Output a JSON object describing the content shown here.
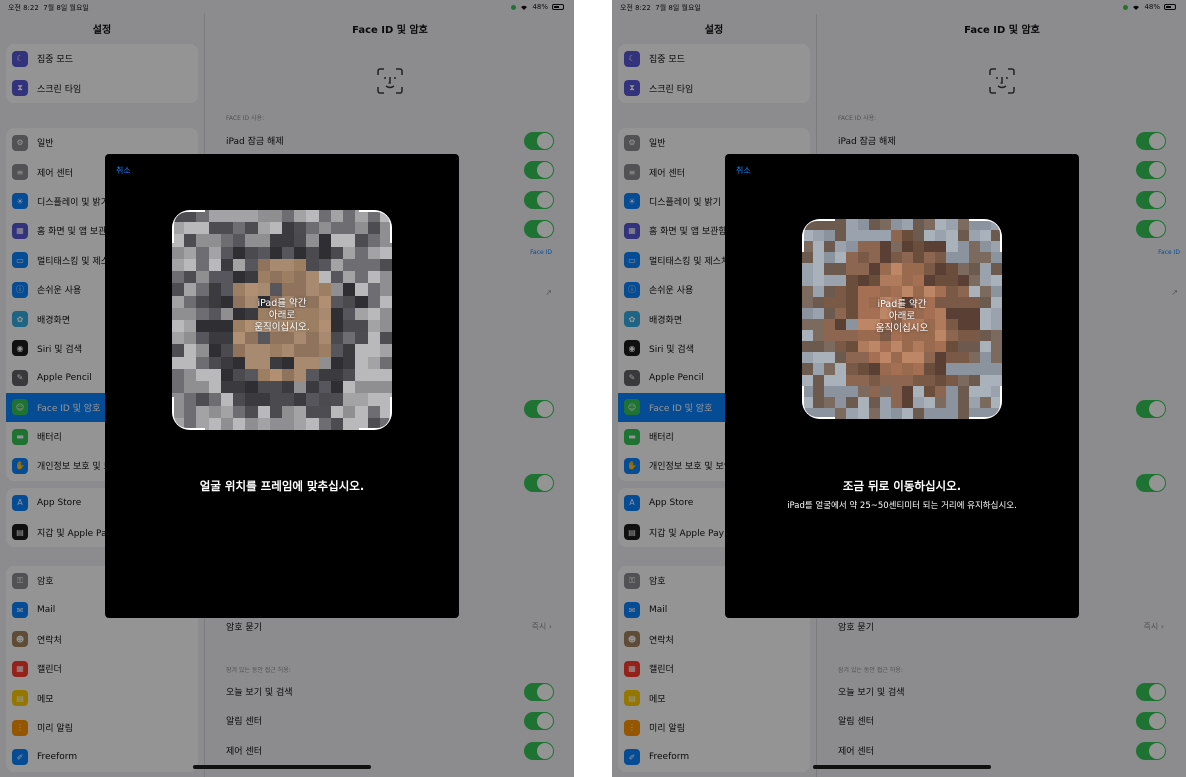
{
  "status": {
    "time": "오전 8:22",
    "date": "7월 8일 월요일",
    "battery": "48%"
  },
  "sidebar": {
    "title": "설정",
    "groups": [
      [
        {
          "label": "집중 모드",
          "icon": "moon-icon",
          "color": "#5856d6"
        },
        {
          "label": "스크린 타임",
          "icon": "hourglass-icon",
          "color": "#5856d6"
        }
      ],
      [
        {
          "label": "일반",
          "icon": "gear-icon",
          "color": "#8e8e93"
        },
        {
          "label": "제어 센터",
          "icon": "switches-icon",
          "color": "#8e8e93"
        },
        {
          "label": "디스플레이 및 밝기",
          "icon": "sun-icon",
          "color": "#0a84ff"
        },
        {
          "label": "홈 화면 및 앱 보관함",
          "icon": "grid-icon",
          "color": "#5856d6"
        },
        {
          "label": "멀티태스킹 및 제스처",
          "icon": "multitask-icon",
          "color": "#0a84ff"
        },
        {
          "label": "손쉬운 사용",
          "icon": "accessibility-icon",
          "color": "#0a84ff"
        },
        {
          "label": "배경화면",
          "icon": "flower-icon",
          "color": "#32ade6"
        },
        {
          "label": "Siri 및 검색",
          "icon": "siri-icon",
          "color": "#1c1c1e"
        },
        {
          "label": "Apple Pencil",
          "icon": "pencil-icon",
          "color": "#636366"
        },
        {
          "label": "Face ID 및 암호",
          "icon": "faceid-icon",
          "color": "#34c759"
        },
        {
          "label": "배터리",
          "icon": "battery-icon",
          "color": "#34c759"
        },
        {
          "label": "개인정보 보호 및 보안",
          "icon": "hand-icon",
          "color": "#0a84ff"
        }
      ],
      [
        {
          "label": "App Store",
          "icon": "appstore-icon",
          "color": "#0a84ff"
        },
        {
          "label": "지갑 및 Apple Pay",
          "icon": "wallet-icon",
          "color": "#1c1c1e"
        }
      ],
      [
        {
          "label": "암호",
          "icon": "key-icon",
          "color": "#8e8e93"
        },
        {
          "label": "Mail",
          "icon": "mail-icon",
          "color": "#0a84ff"
        },
        {
          "label": "연락처",
          "icon": "contacts-icon",
          "color": "#a2845e"
        },
        {
          "label": "캘린더",
          "icon": "calendar-icon",
          "color": "#ff3b30"
        },
        {
          "label": "메모",
          "icon": "notes-icon",
          "color": "#ffcc00"
        },
        {
          "label": "미리 알림",
          "icon": "reminders-icon",
          "color": "#ff9500"
        },
        {
          "label": "Freeform",
          "icon": "freeform-icon",
          "color": "#0a84ff"
        }
      ]
    ]
  },
  "detail": {
    "title": "Face ID 및 암호",
    "section_faceid": "FACE ID 사용:",
    "unlock_label": "iPad 잠금 해제",
    "note_link": "Face ID",
    "passcode_label": "암호 묻기",
    "passcode_value": "즉시",
    "locked_section": "잠겨 있는 동안 접근 허용:",
    "locked_items": [
      "오늘 보기 및 검색",
      "알림 센터",
      "제어 센터"
    ]
  },
  "left_modal": {
    "cancel": "취소",
    "camera_msg": [
      "iPad를 약간",
      "아래로",
      "움직이십시오."
    ],
    "instruction": "얼굴 위치를 프레임에 맞추십시오."
  },
  "right_modal": {
    "cancel": "취소",
    "camera_msg": [
      "iPad를 약간",
      "아래로",
      "움직이십시오"
    ],
    "instruction": "조금 뒤로 이동하십시오.",
    "sub_instruction": "iPad를 얼굴에서 약 25~50센티미터 되는 거리에 유지하십시오."
  }
}
